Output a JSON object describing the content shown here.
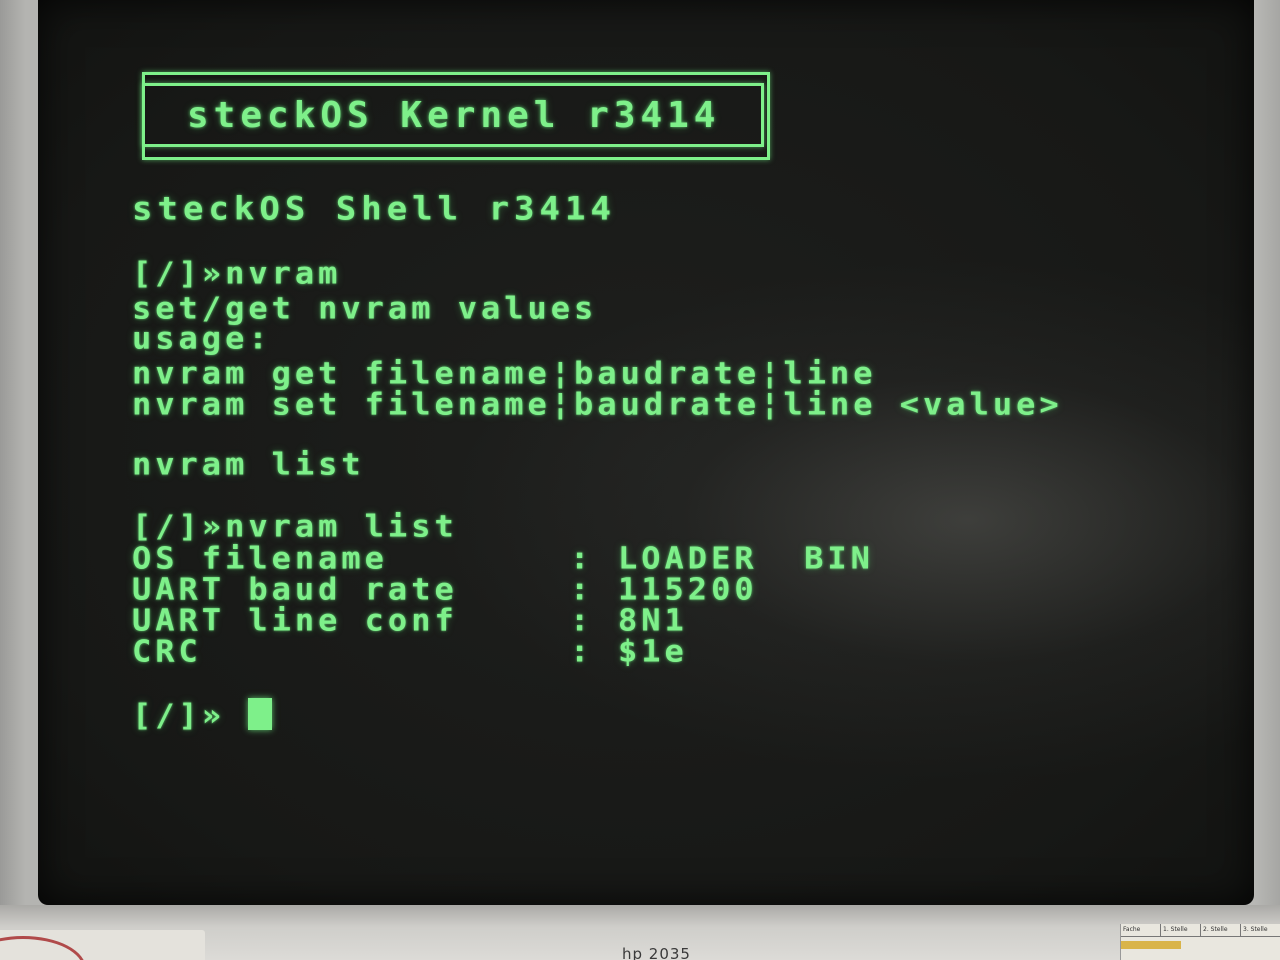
{
  "kernel_banner": "steckOS Kernel r3414",
  "shell_title": "steckOS Shell r3414",
  "session1": {
    "prompt": "[/]»",
    "command": "nvram",
    "help_lines": [
      "set/get nvram values",
      "usage:",
      "nvram get filename¦baudrate¦line",
      "nvram set filename¦baudrate¦line <value>",
      "nvram list"
    ]
  },
  "session2": {
    "prompt": "[/]»",
    "command": "nvram list",
    "rows": [
      {
        "key": "OS filename",
        "sep": ":",
        "value": "LOADER  BIN"
      },
      {
        "key": "UART baud rate",
        "sep": ":",
        "value": "115200"
      },
      {
        "key": "UART line conf",
        "sep": ":",
        "value": "8N1"
      },
      {
        "key": "CRC",
        "sep": ":",
        "value": "$1e"
      }
    ]
  },
  "current_prompt": "[/]»",
  "monitor": {
    "brand_text": "hp 2035",
    "sticker_cells": [
      "Fache",
      "1. Stelle",
      "2. Stelle",
      "3. Stelle"
    ]
  },
  "colors": {
    "phosphor": "#7ef08a",
    "screen": "#171816"
  }
}
